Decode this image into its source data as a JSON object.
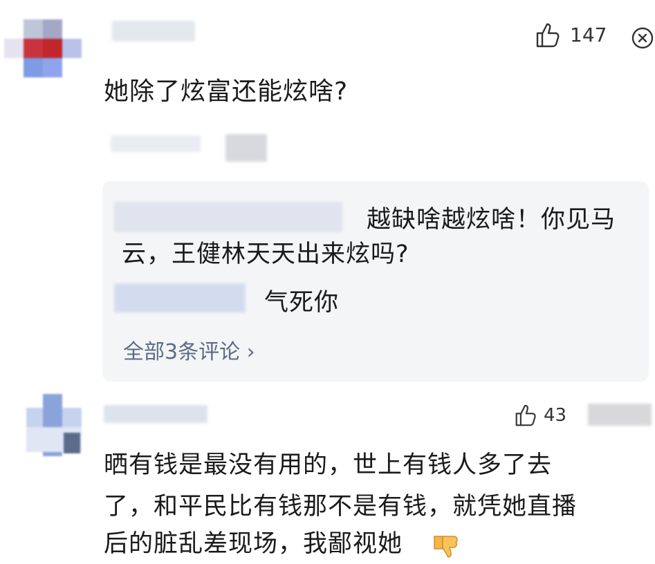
{
  "comment1": {
    "text": "她除了炫富还能炫啥?",
    "likes": "147"
  },
  "replies": {
    "reply1_text_line1": "越缺啥越炫啥！你见马",
    "reply1_text_line2": "云，王健林天天出来炫吗?",
    "reply2_text": "气死你",
    "view_all": "全部3条评论 ›"
  },
  "comment2": {
    "likes": "43",
    "text_line1": "晒有钱是最没有用的，世上有钱人多了去",
    "text_line2": "了，和平民比有钱那不是有钱，就凭她直播",
    "text_line3": "后的脏乱差现场，我鄙视她"
  },
  "icons": {
    "like": "thumbs-up-icon",
    "close": "close-icon",
    "dislike_emoji": "thumbs-down-emoji"
  }
}
